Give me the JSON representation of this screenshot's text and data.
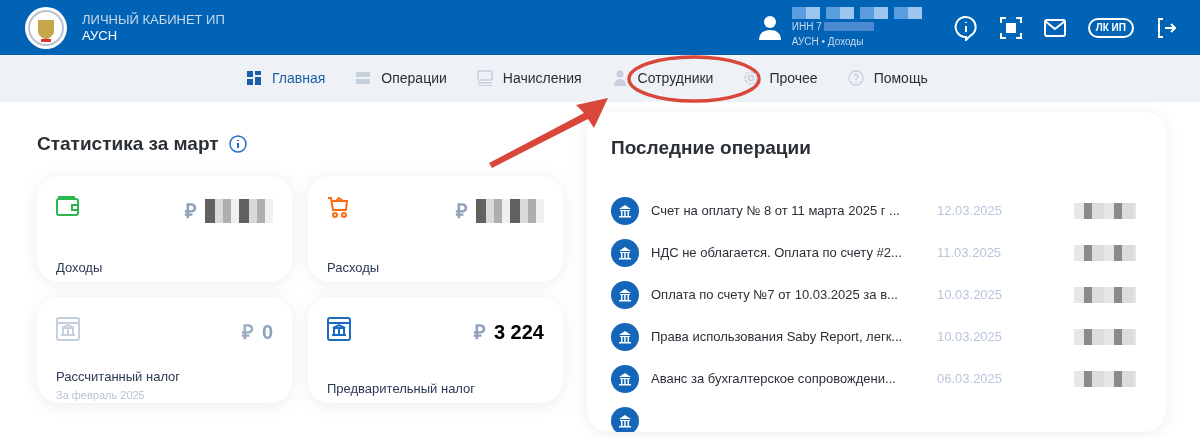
{
  "header": {
    "title": "ЛИЧНЫЙ КАБИНЕТ ИП",
    "subtitle": "АУСН",
    "user": {
      "inn": "ИНН 7",
      "regime": "АУСН • Доходы"
    },
    "badge": "ЛК ИП"
  },
  "nav": [
    {
      "label": "Главная",
      "selected": true,
      "highlighted": false
    },
    {
      "label": "Операции",
      "selected": false,
      "highlighted": false
    },
    {
      "label": "Начисления",
      "selected": false,
      "highlighted": false
    },
    {
      "label": "Сотрудники",
      "selected": false,
      "highlighted": true
    },
    {
      "label": "Прочее",
      "selected": false,
      "highlighted": false
    },
    {
      "label": "Помощь",
      "selected": false,
      "highlighted": false
    }
  ],
  "stats": {
    "title": "Статистика за март",
    "cards": [
      {
        "kind": "income",
        "label": "Доходы",
        "currency": "₽",
        "redacted": true,
        "muted": false
      },
      {
        "kind": "expense",
        "label": "Расходы",
        "currency": "₽",
        "redacted": true,
        "muted": false
      },
      {
        "kind": "tax",
        "label": "Рассчитанный налог",
        "sublabel": "За февраль 2025",
        "currency": "₽",
        "amount": "0",
        "redacted": false,
        "muted": true
      },
      {
        "kind": "tax",
        "label": "Предварительный налог",
        "currency": "₽",
        "amount": "3 224",
        "redacted": false,
        "muted": false
      }
    ]
  },
  "operations": {
    "title": "Последние операции",
    "rows": [
      {
        "text": "Счет на оплату № 8 от 11 марта 2025 г ...",
        "date": "12.03.2025"
      },
      {
        "text": "НДС не облагается. Оплата по счету #2...",
        "date": "11.03.2025"
      },
      {
        "text": "Оплата по счету №7 от 10.03.2025 за в...",
        "date": "10.03.2025"
      },
      {
        "text": "Права использования Saby Report, легк...",
        "date": "10.03.2025"
      },
      {
        "text": "Аванс за бухгалтерское сопровождени...",
        "date": "06.03.2025"
      }
    ]
  }
}
